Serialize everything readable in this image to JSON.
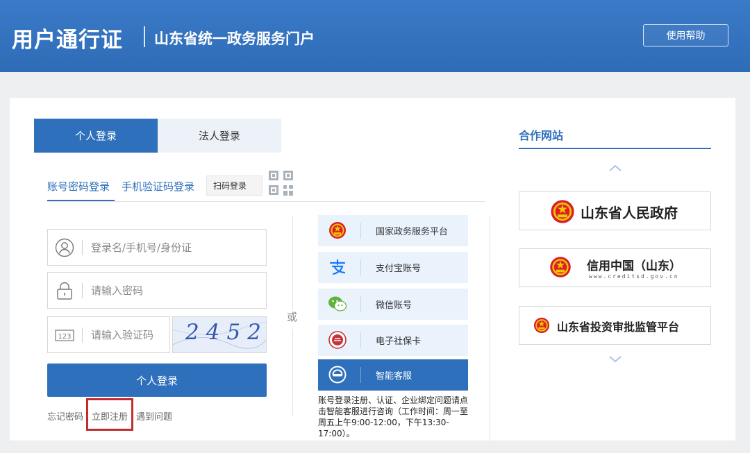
{
  "header": {
    "brand": "用户通行证",
    "subtitle": "山东省统一政务服务门户",
    "help_label": "使用帮助"
  },
  "login_tabs": [
    {
      "label": "个人登录",
      "active": true
    },
    {
      "label": "法人登录",
      "active": false
    }
  ],
  "method_tabs": {
    "password": "账号密码登录",
    "sms": "手机验证码登录",
    "scan": "扫码登录"
  },
  "form": {
    "username_placeholder": "登录名/手机号/身份证",
    "password_placeholder": "请输入密码",
    "captcha_placeholder": "请输入验证码",
    "captcha_value": "2452",
    "captcha_icon_text": "123",
    "submit_label": "个人登录"
  },
  "links": {
    "forgot": "忘记密码",
    "register": "立即注册",
    "problem": "遇到问题"
  },
  "or_label": "或",
  "quick_logins": [
    {
      "label": "国家政务服务平台",
      "icon": "national-emblem-icon"
    },
    {
      "label": "支付宝账号",
      "icon": "alipay-icon"
    },
    {
      "label": "微信账号",
      "icon": "wechat-icon"
    },
    {
      "label": "电子社保卡",
      "icon": "social-security-icon"
    },
    {
      "label": "智能客服",
      "icon": "customer-service-icon"
    }
  ],
  "help_text": "账号登录注册、认证、企业绑定问题请点击智能客服进行咨询（工作时间：周一至周五上午9:00-12:00，下午13:30-17:00）。",
  "partners": {
    "title": "合作网站",
    "items": [
      {
        "label": "山东省人民政府"
      },
      {
        "label": "信用中国（山东）",
        "url": "www.creditsd.gov.cn"
      },
      {
        "label": "山东省投资审批监管平台"
      }
    ]
  },
  "colors": {
    "primary": "#2e70bb",
    "header": "#3676c2",
    "highlight": "#c32c2c",
    "quick_bg": "#eaf2fb"
  }
}
